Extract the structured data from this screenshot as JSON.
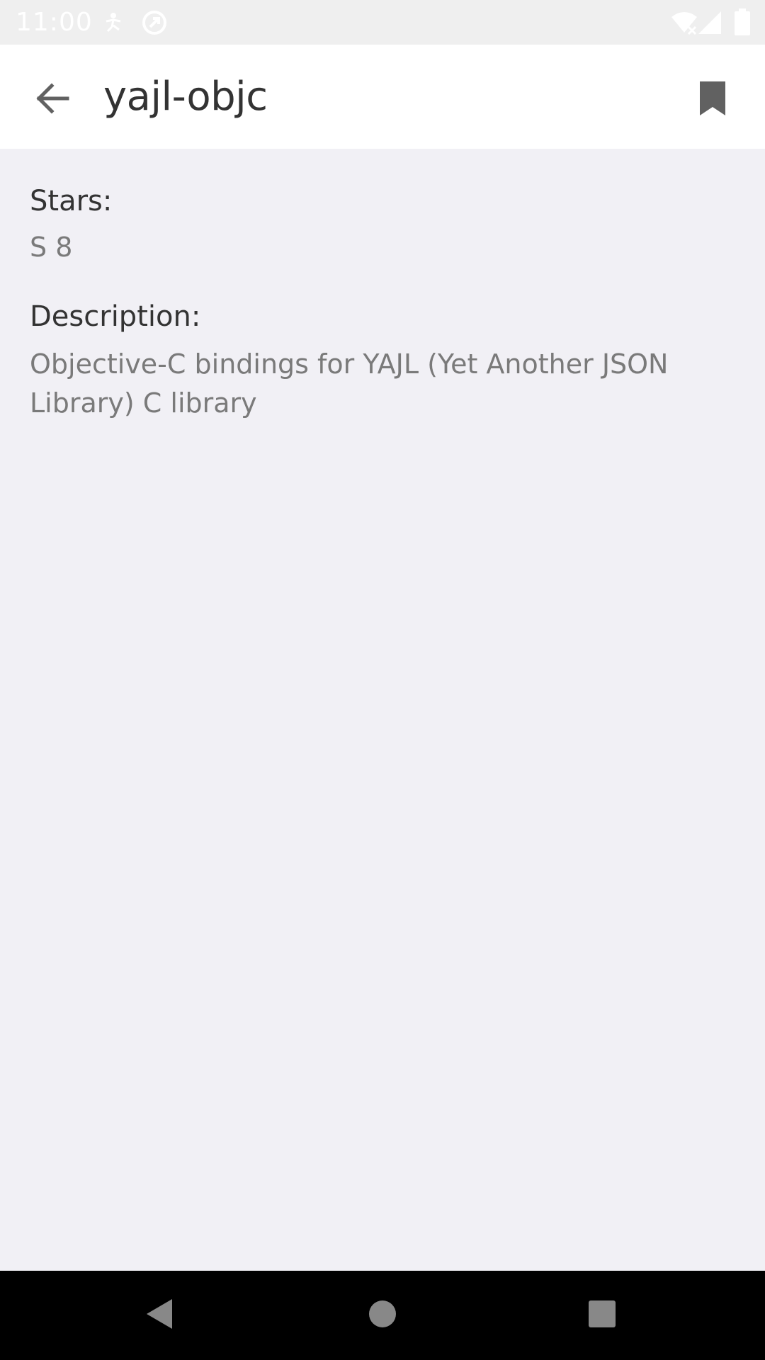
{
  "status_bar": {
    "time": "11:00",
    "icons": [
      "accessibility-icon",
      "sync-icon",
      "wifi-off-icon",
      "signal-icon",
      "battery-icon"
    ]
  },
  "app_bar": {
    "title": "yajl-objc",
    "back_icon": "arrow-back-icon",
    "bookmark_icon": "bookmark-icon"
  },
  "details": {
    "stars_label": "Stars:",
    "stars_value": "S 8",
    "description_label": "Description:",
    "description_value": "Objective-C bindings for YAJL (Yet Another JSON Library) C library"
  },
  "nav_bar": {
    "buttons": [
      "back-triangle-icon",
      "home-circle-icon",
      "recents-square-icon"
    ]
  },
  "colors": {
    "background": "#f1f0f5",
    "app_bar": "#ffffff",
    "title_text": "#333333",
    "secondary_text": "#7a7a7a",
    "icon": "#616161"
  }
}
